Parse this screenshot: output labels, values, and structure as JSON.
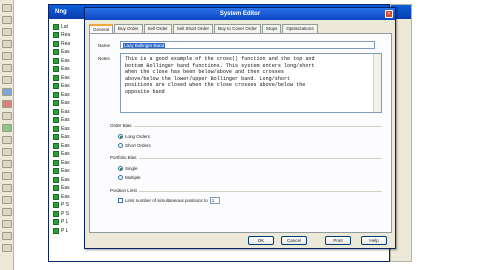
{
  "background_window": {
    "title": "Nng",
    "list_items": [
      "Lat",
      "Rea",
      "Rea",
      "Eas",
      "Eas",
      "Eas",
      "Eas",
      "Eas",
      "Eas",
      "Eas",
      "Eas",
      "Eas",
      "Eas",
      "Eas",
      "Eas",
      "Eas",
      "Eas",
      "Eas",
      "Eas",
      "Eas",
      "Eas",
      "P S",
      "P S",
      "P L",
      "P L"
    ]
  },
  "dialog": {
    "title": "System Editor",
    "close_label": "×",
    "tabs": [
      "General",
      "Buy Order",
      "Sell Order",
      "Sell Short Order",
      "Buy to Cover Order",
      "Stops",
      "Optimizations"
    ],
    "name_label": "Name",
    "name_value": "Lazy Bollinger Band",
    "notes_label": "Notes",
    "notes_lines": [
      "This is a good example of the cross() function and the top and",
      "bottom Bollinger band functions.  This system enters long/short",
      "when the close has been below/above and then crosses",
      "above/below the lower/upper Bollinger band.  Long/short",
      "positions are closed when the close crosses above/below the",
      "opposite band"
    ],
    "order_bias": {
      "title": "Order Bias",
      "options": [
        "Long Orders",
        "Short Orders"
      ],
      "selected": "Long Orders"
    },
    "portfolio_bias": {
      "title": "Portfolio Bias",
      "options": [
        "Single",
        "Multiple"
      ],
      "selected": "Single"
    },
    "position_limit": {
      "title": "Position Limit",
      "checkbox_label": "Limit number of simultaneous positions to",
      "value": "1"
    },
    "buttons": [
      "OK",
      "Cancel",
      "Print",
      "Help"
    ]
  },
  "colors": {
    "titlebar": "#0a44c2",
    "dialog_bg": "#ece9d8",
    "selection": "#316ac5"
  }
}
